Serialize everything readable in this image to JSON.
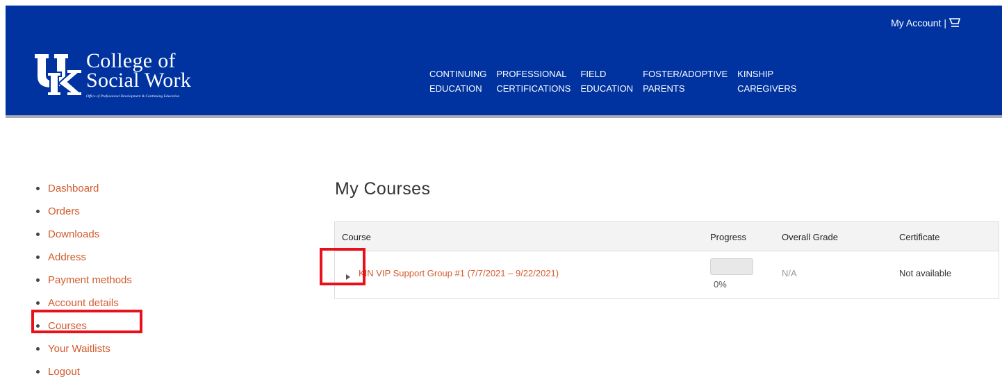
{
  "header": {
    "account_label": "My Account |",
    "logo": {
      "line1": "College of",
      "line2": "Social Work",
      "tagline": "Office of Professional Development & Continuing Education"
    },
    "nav": [
      {
        "line1": "CONTINUING",
        "line2": "EDUCATION"
      },
      {
        "line1": "PROFESSIONAL",
        "line2": "CERTIFICATIONS"
      },
      {
        "line1": "FIELD",
        "line2": "EDUCATION"
      },
      {
        "line1": "FOSTER/ADOPTIVE",
        "line2": "PARENTS"
      },
      {
        "line1": "KINSHIP",
        "line2": "CAREGIVERS"
      }
    ]
  },
  "sidebar": {
    "items": [
      "Dashboard",
      "Orders",
      "Downloads",
      "Address",
      "Payment methods",
      "Account details",
      "Courses",
      "Your Waitlists",
      "Logout"
    ]
  },
  "main": {
    "title": "My Courses",
    "table": {
      "headers": {
        "course": "Course",
        "progress": "Progress",
        "grade": "Overall Grade",
        "certificate": "Certificate"
      },
      "rows": [
        {
          "course": "KIN VIP Support Group #1 (7/7/2021 – 9/22/2021)",
          "progress_value": 0,
          "progress_text": "0%",
          "grade": "N/A",
          "certificate": "Not available"
        }
      ]
    }
  },
  "colors": {
    "brand": "#0033a0",
    "link": "#d35a2e",
    "annotation": "#e8101a"
  }
}
